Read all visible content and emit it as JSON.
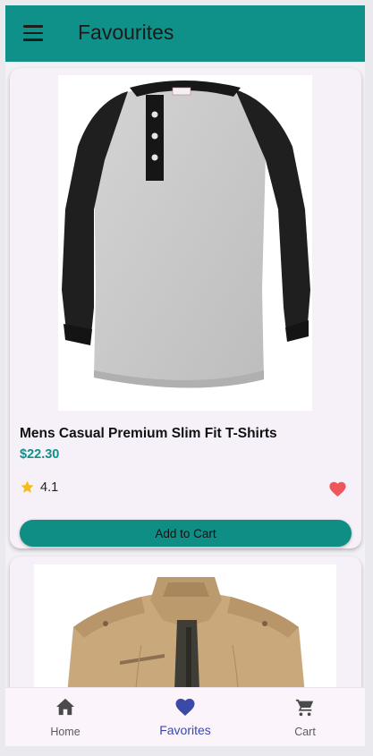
{
  "app_bar": {
    "title": "Favourites",
    "background_color": "#0f9088",
    "menu_icon": "hamburger-menu-icon"
  },
  "products": [
    {
      "name": "Mens Casual Premium Slim Fit T-Shirts",
      "price": "$22.30",
      "rating": "4.1",
      "favorited": true,
      "add_to_cart_label": "Add to Cart",
      "image": "raglan-henley-shirt-image"
    },
    {
      "image": "khaki-jacket-image"
    }
  ],
  "bottom_nav": {
    "items": [
      {
        "label": "Home",
        "icon": "home-icon",
        "active": false
      },
      {
        "label": "Favorites",
        "icon": "heart-icon",
        "active": true
      },
      {
        "label": "Cart",
        "icon": "shopping-cart-icon",
        "active": false
      }
    ]
  },
  "colors": {
    "accent": "#0f9088",
    "price": "#0f9088",
    "favorite_heart": "#f0555a",
    "star": "#f6bd16",
    "active_nav": "#3a4aa6"
  }
}
